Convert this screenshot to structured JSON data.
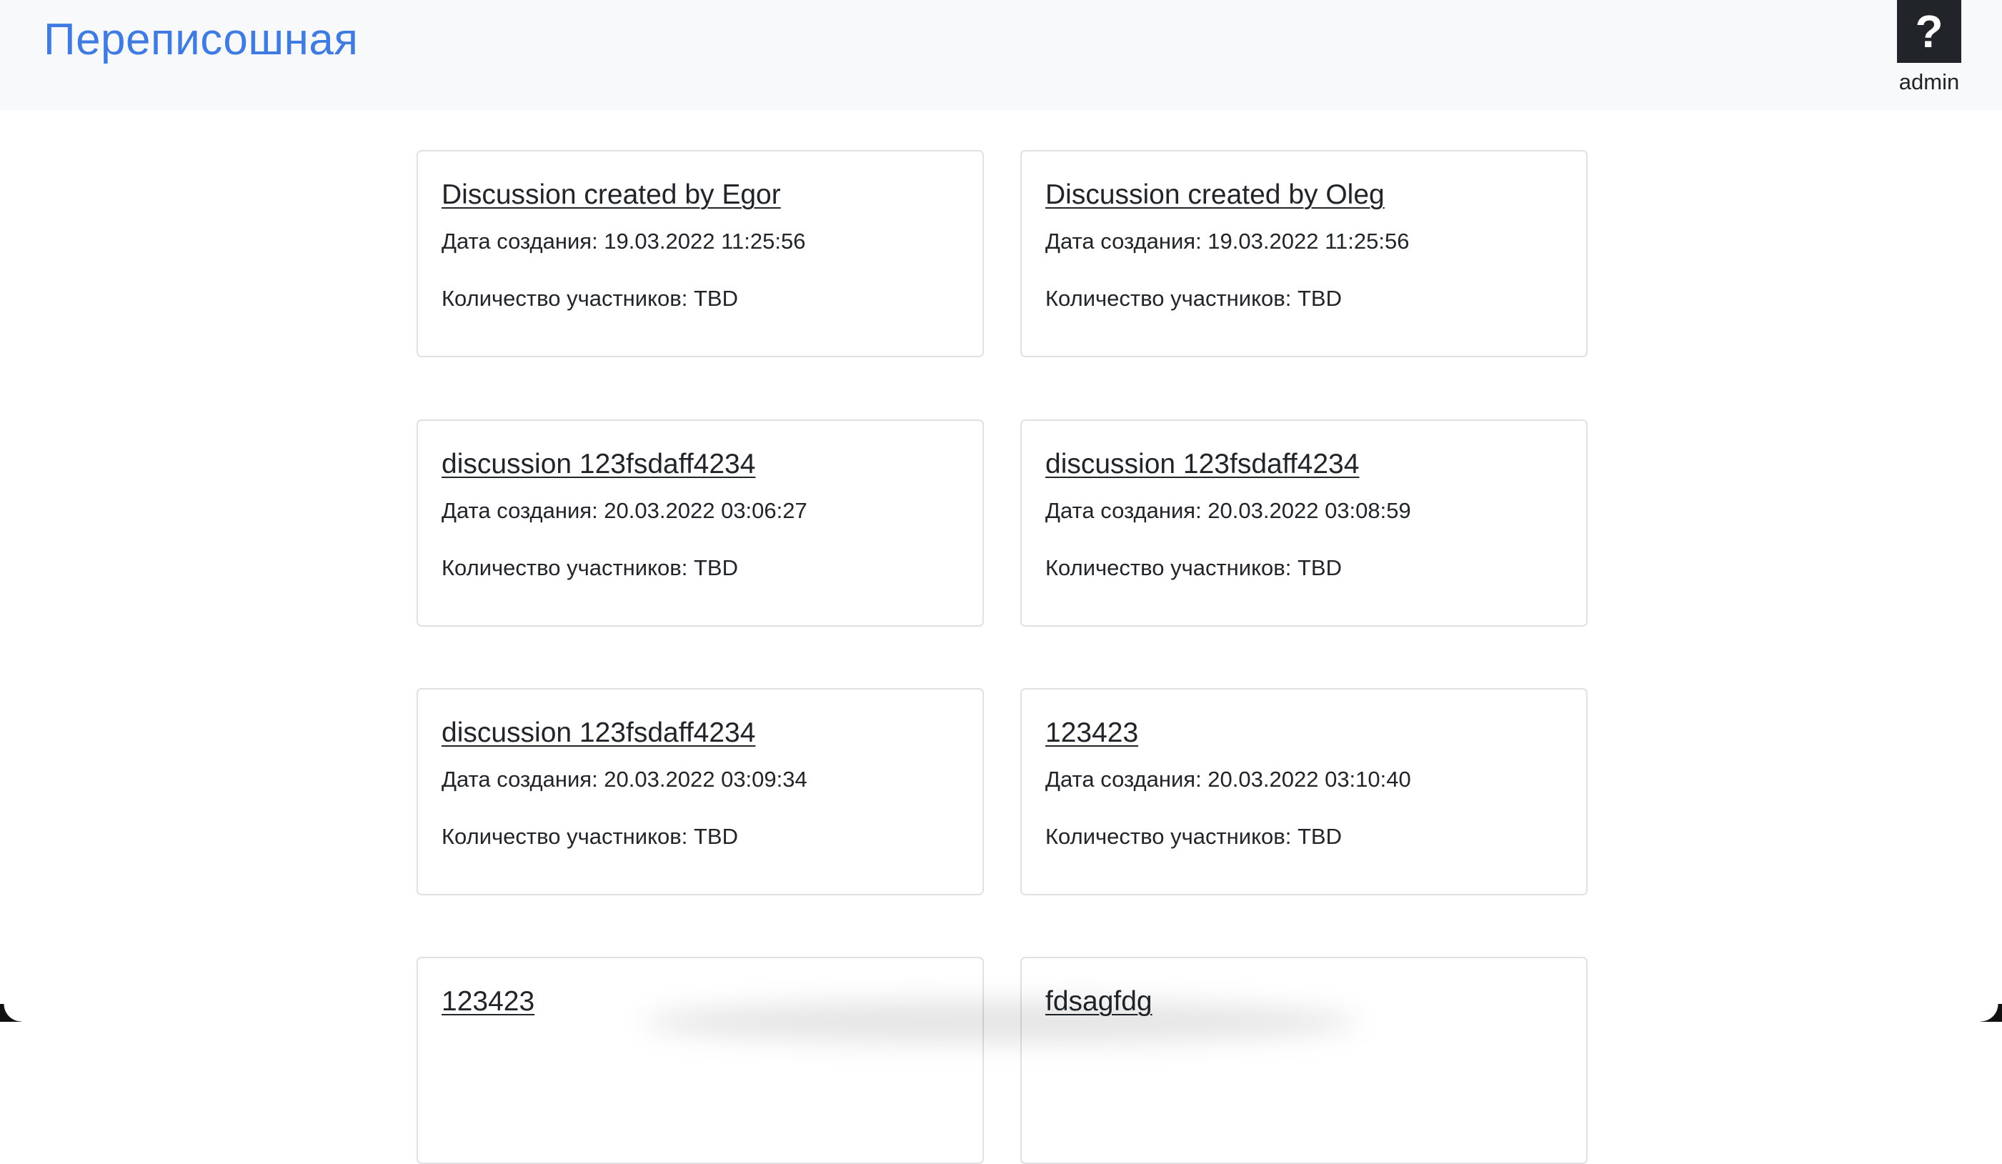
{
  "header": {
    "brand": "Переписошная",
    "help_label": "?",
    "username": "admin"
  },
  "labels": {
    "date_prefix": "Дата создания:",
    "members_prefix": "Количество участников:"
  },
  "cards": [
    {
      "title": "Discussion created by Egor",
      "date": "Дата создания: 19.03.2022 11:25:56",
      "members": "Количество участников: TBD"
    },
    {
      "title": "Discussion created by Oleg",
      "date": "Дата создания: 19.03.2022 11:25:56",
      "members": "Количество участников: TBD"
    },
    {
      "title": "discussion 123fsdaff4234",
      "date": "Дата создания: 20.03.2022 03:06:27",
      "members": "Количество участников: TBD"
    },
    {
      "title": "discussion 123fsdaff4234",
      "date": "Дата создания: 20.03.2022 03:08:59",
      "members": "Количество участников: TBD"
    },
    {
      "title": "discussion 123fsdaff4234",
      "date": "Дата создания: 20.03.2022 03:09:34",
      "members": "Количество участников: TBD"
    },
    {
      "title": "123423",
      "date": "Дата создания: 20.03.2022 03:10:40",
      "members": "Количество участников: TBD"
    },
    {
      "title": "123423",
      "date": "",
      "members": ""
    },
    {
      "title": "fdsagfdg",
      "date": "",
      "members": ""
    }
  ],
  "colors": {
    "brand": "#3f7be0",
    "navbar_bg": "#f8f9fa",
    "text": "#212529",
    "card_border": "#dfe1e4"
  }
}
